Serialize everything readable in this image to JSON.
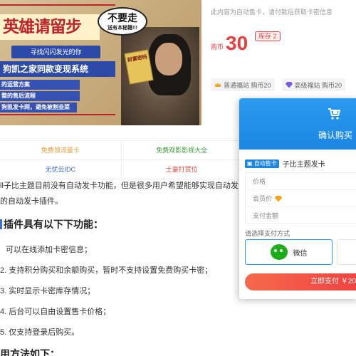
{
  "poster": {
    "title": "英雄请留步",
    "bubble_main": "不要走",
    "bubble_sub": "送有本秘籍!!!",
    "subtitle": "寻找闪闪发光的你",
    "band": "狗凯之家同款变现系统",
    "list": [
      "的运营方案",
      "整的售后流程",
      "狗凯发卡网，避免被割韭菜"
    ],
    "book_text": "财富密码"
  },
  "product": {
    "notice": "此内容为自动售卡，请付款后获取卡密信息",
    "price_unit": "购币",
    "price": "30",
    "stock": "库存 2",
    "members": [
      {
        "icon": "crown-icon",
        "label": "普通福站 购币20"
      },
      {
        "icon": "diamond-icon",
        "label": "高级福站 购币20"
      }
    ]
  },
  "links": [
    [
      "免费领流量卡",
      "免费观影影视大全"
    ],
    [
      "无忧云IDC",
      "土豪打赏位"
    ]
  ],
  "article": {
    "intro_1": "ll子比主题目前没有自动发卡功能，但是很多用户希望能够实现自动发卡",
    "intro_2": "的自动发卡插件。",
    "heading_features": "插件具有以下下功能：",
    "features": [
      "可以在线添加卡密信息；",
      "2. 支持积分购买和余额购买，暂时不支持设置免费购买卡密；",
      "3. 实时显示卡密库存情况；",
      "4. 后台可以自由设置售卡价格；",
      "5. 仅支持登录后购买。"
    ],
    "heading_usage": "用方法如下："
  },
  "modal": {
    "title": "确认购买",
    "auto_tag": "自动售卡",
    "product_name": "子比主题发卡",
    "fields": [
      "价格",
      "会员价",
      "支付金额"
    ],
    "pay_label": "请选择支付方式",
    "wechat_label": "微信",
    "pay_button": "立即支付 ￥20"
  },
  "colors": {
    "accent": "#1c86e3",
    "price": "#ea3d3d",
    "pay_button": "#ef4040",
    "wechat": "#1aad19"
  }
}
